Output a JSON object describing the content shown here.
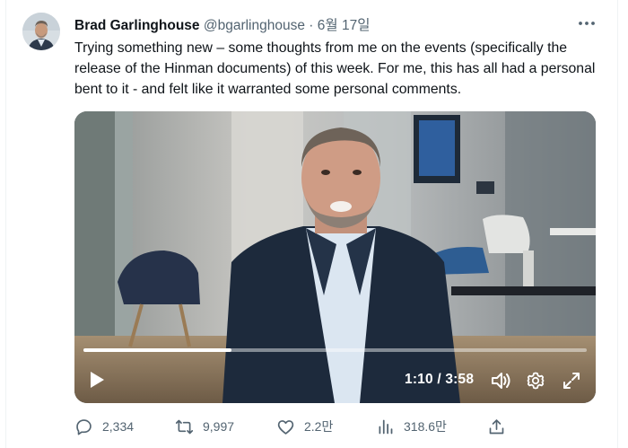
{
  "tweet": {
    "author_name": "Brad Garlinghouse",
    "handle": "@bgarlinghouse",
    "separator": "·",
    "date": "6월 17일",
    "text": "Trying something new – some thoughts from me on the events (specifically the release of the Hinman documents) of this week. For me, this has all had a personal bent to it - and felt like it warranted some personal comments."
  },
  "video": {
    "time_display": "1:10 / 3:58",
    "progress_fraction": 0.294
  },
  "actions": {
    "replies": "2,334",
    "reposts": "9,997",
    "likes": "2.2만",
    "views": "318.6만"
  },
  "icons": [
    "more-icon",
    "play-icon",
    "volume-icon",
    "settings-icon",
    "fullscreen-icon",
    "reply-icon",
    "repost-icon",
    "like-icon",
    "views-icon",
    "share-icon"
  ],
  "colors": {
    "text": "#0f1419",
    "secondary": "#536471",
    "border": "#eff3f4"
  }
}
